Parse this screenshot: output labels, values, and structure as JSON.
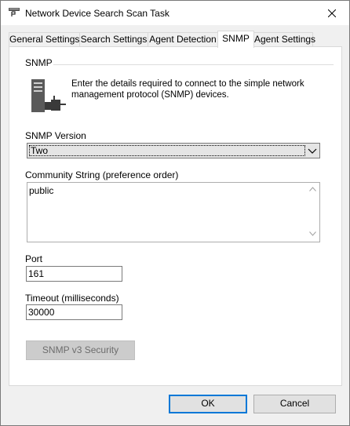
{
  "window": {
    "title": "Network Device Search Scan Task"
  },
  "tabs": [
    {
      "label": "General Settings"
    },
    {
      "label": "Search Settings"
    },
    {
      "label": "Agent Detection"
    },
    {
      "label": "SNMP"
    },
    {
      "label": "Agent Settings"
    }
  ],
  "active_tab": "SNMP",
  "snmp": {
    "group_label": "SNMP",
    "description": "Enter the details required to connect to the simple network management protocol (SNMP) devices.",
    "version_label": "SNMP Version",
    "version_value": "Two",
    "community_label": "Community String (preference order)",
    "community_value": "public",
    "port_label": "Port",
    "port_value": "161",
    "timeout_label": "Timeout (milliseconds)",
    "timeout_value": "30000",
    "v3_security_button": "SNMP v3 Security"
  },
  "footer": {
    "ok_label": "OK",
    "cancel_label": "Cancel"
  },
  "icons": {
    "app": "scan-task-icon",
    "device": "network-device-icon",
    "close": "close-icon"
  },
  "colors": {
    "focus_border": "#0078d7",
    "tab_border": "#d9d9d9",
    "disabled_bg": "#cccccc"
  }
}
